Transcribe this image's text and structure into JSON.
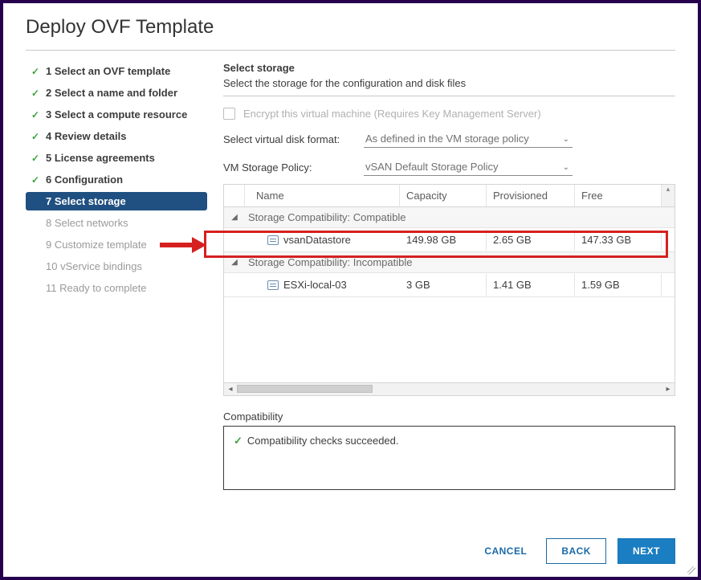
{
  "title": "Deploy OVF Template",
  "steps": [
    {
      "label": "1 Select an OVF template",
      "state": "done"
    },
    {
      "label": "2 Select a name and folder",
      "state": "done"
    },
    {
      "label": "3 Select a compute resource",
      "state": "done"
    },
    {
      "label": "4 Review details",
      "state": "done"
    },
    {
      "label": "5 License agreements",
      "state": "done"
    },
    {
      "label": "6 Configuration",
      "state": "done"
    },
    {
      "label": "7 Select storage",
      "state": "active"
    },
    {
      "label": "8 Select networks",
      "state": "future"
    },
    {
      "label": "9 Customize template",
      "state": "future"
    },
    {
      "label": "10 vService bindings",
      "state": "future"
    },
    {
      "label": "11 Ready to complete",
      "state": "future"
    }
  ],
  "section": {
    "title": "Select storage",
    "subtitle": "Select the storage for the configuration and disk files"
  },
  "encrypt": {
    "label": "Encrypt this virtual machine (Requires Key Management Server)"
  },
  "diskFormat": {
    "label": "Select virtual disk format:",
    "value": "As defined in the VM storage policy"
  },
  "storagePolicy": {
    "label": "VM Storage Policy:",
    "value": "vSAN Default Storage Policy"
  },
  "grid": {
    "headers": {
      "name": "Name",
      "capacity": "Capacity",
      "provisioned": "Provisioned",
      "free": "Free"
    },
    "groups": [
      {
        "label": "Storage Compatibility: Compatible",
        "rows": [
          {
            "name": "vsanDatastore",
            "capacity": "149.98 GB",
            "provisioned": "2.65 GB",
            "free": "147.33 GB"
          }
        ]
      },
      {
        "label": "Storage Compatibility: Incompatible",
        "rows": [
          {
            "name": "ESXi-local-03",
            "capacity": "3 GB",
            "provisioned": "1.41 GB",
            "free": "1.59 GB"
          }
        ]
      }
    ]
  },
  "compat": {
    "label": "Compatibility",
    "message": "Compatibility checks succeeded."
  },
  "buttons": {
    "cancel": "CANCEL",
    "back": "BACK",
    "next": "NEXT"
  }
}
